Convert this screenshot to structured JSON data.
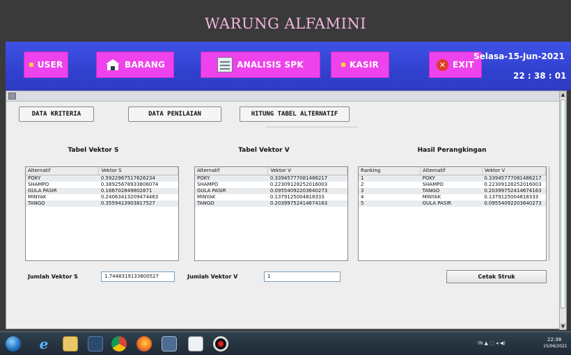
{
  "app": {
    "title": "WARUNG ALFAMINI"
  },
  "menu": {
    "user": "USER",
    "barang": "BARANG",
    "analisis": "ANALISIS SPK",
    "kasir": "KASIR",
    "exit": "EXIT"
  },
  "datetime": {
    "date": "Selasa-15-Jun-2021",
    "time": "22 : 38 : 01"
  },
  "tabs": {
    "kriteria": "DATA KRITERIA",
    "penilaian": "DATA PENILAIAN",
    "hitung": "HITUNG TABEL ALTERNATIF"
  },
  "sections": {
    "vektor_s": "Tabel Vektor S",
    "vektor_v": "Tabel Vektor V",
    "ranking": "Hasil Perangkingan"
  },
  "table_s": {
    "headers": [
      "Alternatif",
      "Vektor S"
    ],
    "rows": [
      [
        "POKY",
        "0.5922967517626234"
      ],
      [
        "SHAMPO",
        "0.38925678933806074"
      ],
      [
        "GULA PASIR",
        "0.166702849802871"
      ],
      [
        "MINYAK",
        "0.24063413209474463"
      ],
      [
        "TANGO",
        "0.3559413903817527"
      ]
    ]
  },
  "table_v": {
    "headers": [
      "Alternatif",
      "Vektor V"
    ],
    "rows": [
      [
        "POKY",
        "0.33945777081486217"
      ],
      [
        "SHAMPO",
        "0.22309128252016003"
      ],
      [
        "GULA PASIR",
        "0.09554092203640273"
      ],
      [
        "MINYAK",
        "0.1379125004818333"
      ],
      [
        "TANGO",
        "0.20399752414674163"
      ]
    ]
  },
  "table_rank": {
    "headers": [
      "Ranking",
      "Alternatif",
      "Vektor V"
    ],
    "rows": [
      [
        "1",
        "POKY",
        "0.33945777081486217"
      ],
      [
        "2",
        "SHAMPO",
        "0.22309128252016003"
      ],
      [
        "3",
        "TANGO",
        "0.20399752414674163"
      ],
      [
        "4",
        "MINYAK",
        "0.1379125004818333"
      ],
      [
        "5",
        "GULA PASIR",
        "0.09554092203640273"
      ]
    ]
  },
  "footer": {
    "jumlah_s_label": "Jumlah Vektor S",
    "jumlah_s_value": "1.7448319133800527",
    "jumlah_v_label": "Jumlah Vektor V",
    "jumlah_v_value": "1",
    "cetak_label": "Cetak Struk"
  },
  "taskbar": {
    "tray_text": "IN ▲ ⬚ ◂ ◀)",
    "clock_time": "22:38",
    "clock_date": "15/06/2021"
  },
  "colors": {
    "menu_band": "#3141cf",
    "menu_button": "#ee42ec",
    "title_text": "#f3b8dc",
    "background": "#3a3a3a"
  },
  "icons": {
    "user": "square-dot-icon",
    "barang": "house-icon",
    "analisis": "spreadsheet-icon",
    "kasir": "square-dot-icon",
    "exit": "close-circle-icon"
  }
}
